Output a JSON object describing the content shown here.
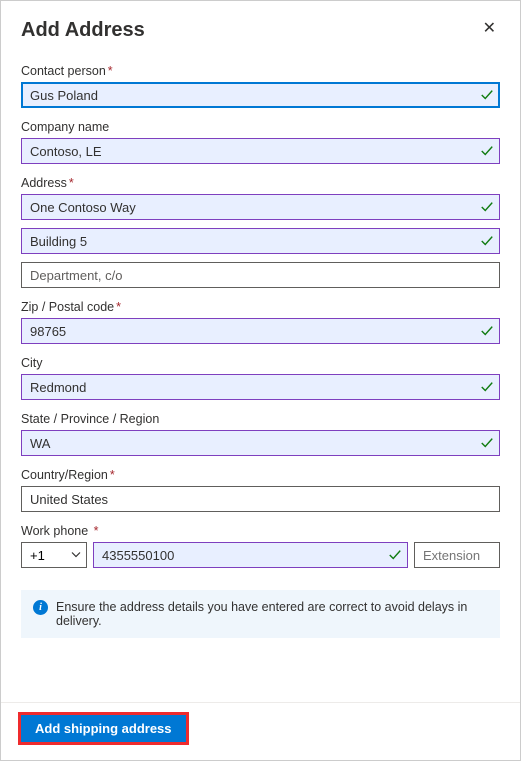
{
  "header": {
    "title": "Add Address"
  },
  "fields": {
    "contact": {
      "label": "Contact person",
      "value": "Gus Poland",
      "required": true
    },
    "company": {
      "label": "Company name",
      "value": "Contoso, LE",
      "required": false
    },
    "address": {
      "label": "Address",
      "required": true,
      "line1": "One Contoso Way",
      "line2": "Building 5",
      "line3_placeholder": "Department, c/o"
    },
    "zip": {
      "label": "Zip / Postal code",
      "value": "98765",
      "required": true
    },
    "city": {
      "label": "City",
      "value": "Redmond",
      "required": false
    },
    "state": {
      "label": "State / Province / Region",
      "value": "WA",
      "required": false
    },
    "country": {
      "label": "Country/Region",
      "value": "United States",
      "required": true
    },
    "phone": {
      "label": "Work phone",
      "required": true,
      "country_code": "+1",
      "number": "4355550100",
      "extension_placeholder": "Extension"
    }
  },
  "info": {
    "text": "Ensure the address details you have entered are correct to avoid delays in delivery."
  },
  "footer": {
    "submit_label": "Add shipping address"
  }
}
